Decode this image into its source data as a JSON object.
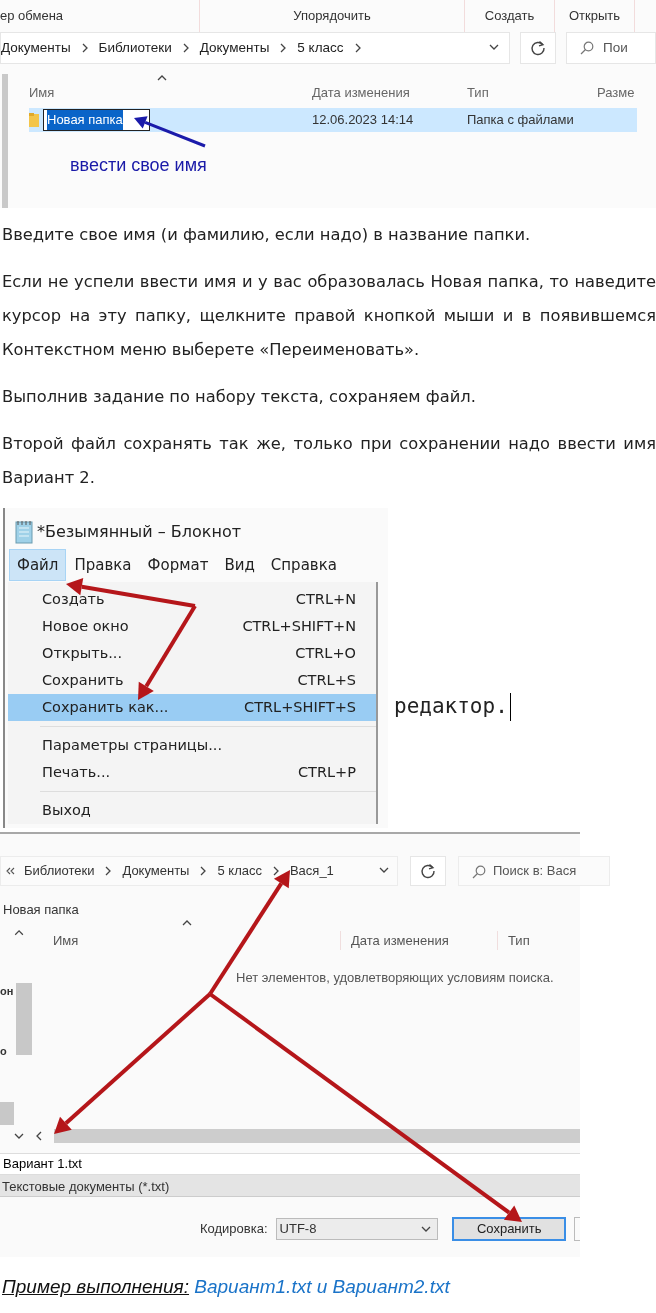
{
  "explorer": {
    "toolbar": [
      "ер обмена",
      "Упорядочить",
      "Создать",
      "Открыть"
    ],
    "breadcrumbs": [
      "Документы",
      "Библиотеки",
      "Документы",
      "5 класс"
    ],
    "search": {
      "placeholder": "Пои"
    },
    "columns": [
      "Имя",
      "Дата изменения",
      "Тип",
      "Разме"
    ],
    "rows": [
      {
        "name": "Новая папка",
        "date": "12.06.2023 14:14",
        "type": "Папка с файлами",
        "selected": true,
        "editing": true
      }
    ],
    "annotation": "ввести свое имя"
  },
  "paragraphs": [
    "Введите свое имя (и фамилию, если надо) в название папки.",
    "Если не успели ввести имя и у вас образовалась Новая папка, то наведите курсор на эту папку, щелкните правой кнопкой мыши и в появившемся Контекстном меню выберете «Переименовать».",
    "Выполнив задание по набору текста, сохраняем файл.",
    "Второй файл сохранять так же, только при сохранении надо ввести имя Вариант 2."
  ],
  "notepad": {
    "title": "*Безымянный – Блокнот",
    "menu": [
      {
        "label": "Файл",
        "selected": true
      },
      {
        "label": "Правка",
        "selected": false
      },
      {
        "label": "Формат",
        "selected": false
      },
      {
        "label": "Вид",
        "selected": false
      },
      {
        "label": "Справка",
        "selected": false
      }
    ],
    "file_menu": [
      {
        "kind": "item",
        "label": "Создать",
        "shortcut": "CTRL+N",
        "selected": false
      },
      {
        "kind": "item",
        "label": "Новое окно",
        "shortcut": "CTRL+SHIFT+N",
        "selected": false
      },
      {
        "kind": "item",
        "label": "Открыть...",
        "shortcut": "CTRL+O",
        "selected": false
      },
      {
        "kind": "item",
        "label": "Сохранить",
        "shortcut": "CTRL+S",
        "selected": false
      },
      {
        "kind": "item",
        "label": "Сохранить как...",
        "shortcut": "CTRL+SHIFT+S",
        "selected": true
      },
      {
        "kind": "separator"
      },
      {
        "kind": "item",
        "label": "Параметры страницы...",
        "selected": false
      },
      {
        "kind": "item",
        "label": "Печать...",
        "shortcut": "CTRL+P",
        "selected": false
      },
      {
        "kind": "separator"
      },
      {
        "kind": "item",
        "label": "Выход",
        "selected": false
      }
    ],
    "document_text": "редактор."
  },
  "save_dialog": {
    "breadcrumbs": [
      "Библиотеки",
      "Документы",
      "5 класс",
      "Вася_1"
    ],
    "search": {
      "placeholder": "Поиск в: Вася"
    },
    "new_folder": "Новая папка",
    "columns": [
      "Имя",
      "Дата изменения",
      "Тип"
    ],
    "empty_message": "Нет элементов, удовлетворяющих условиям поиска.",
    "nav_fragments": [
      "он",
      "о"
    ],
    "file_name": "Вариант 1.txt",
    "file_type": "Текстовые документы (*.txt)",
    "encoding_label": "Кодировка:",
    "encoding": "UTF-8",
    "save_button": "Сохранить"
  },
  "example": {
    "label": "Пример выполнения:",
    "link": "Вариант1.txt и Вариант2.txt"
  }
}
